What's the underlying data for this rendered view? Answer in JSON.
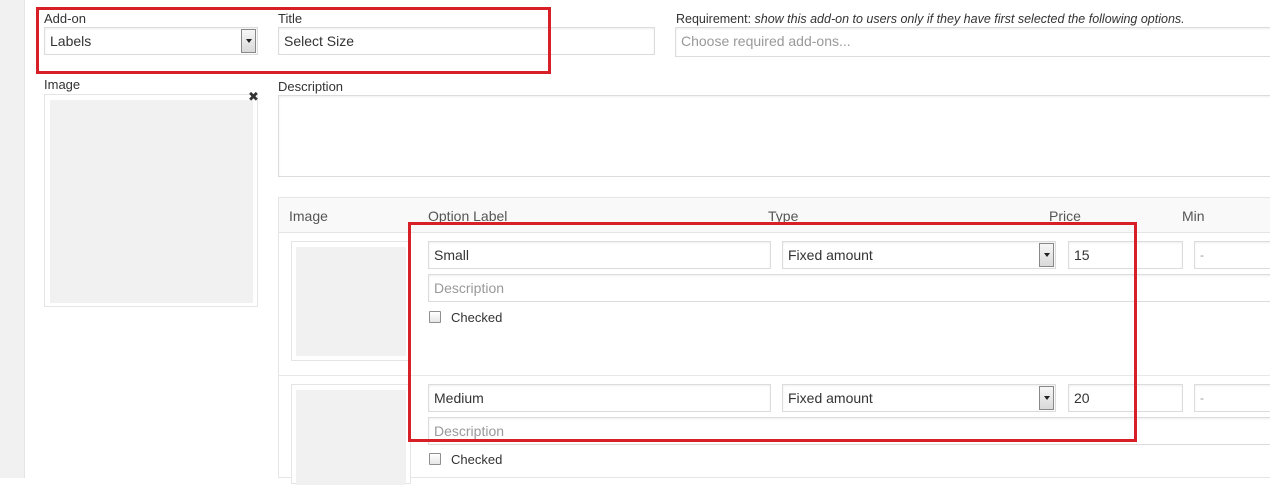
{
  "addon": {
    "label": "Add-on",
    "type_value": "Labels",
    "title_label": "Title",
    "title_value": "Select Size",
    "requirement_label": "Requirement:",
    "requirement_hint": "show this add-on to users only if they have first selected the following options.",
    "requirement_placeholder": "Choose required add-ons...",
    "image_label": "Image",
    "description_label": "Description",
    "description_value": ""
  },
  "options_table": {
    "headers": {
      "image": "Image",
      "option_label": "Option Label",
      "type": "Type",
      "price": "Price",
      "min": "Min"
    },
    "rows": [
      {
        "label": "Small",
        "type": "Fixed amount",
        "price": "15",
        "min": "-",
        "description_placeholder": "Description",
        "checked_label": "Checked",
        "checked": false
      },
      {
        "label": "Medium",
        "type": "Fixed amount",
        "price": "20",
        "min": "-",
        "description_placeholder": "Description",
        "checked_label": "Checked",
        "checked": false
      }
    ]
  },
  "icons": {
    "remove_image": "close-icon",
    "select": "chevron-down-icon"
  },
  "colors": {
    "highlight": "#d61f26",
    "image_placeholder": "#f1f1f1",
    "border": "#dcdcdc"
  }
}
